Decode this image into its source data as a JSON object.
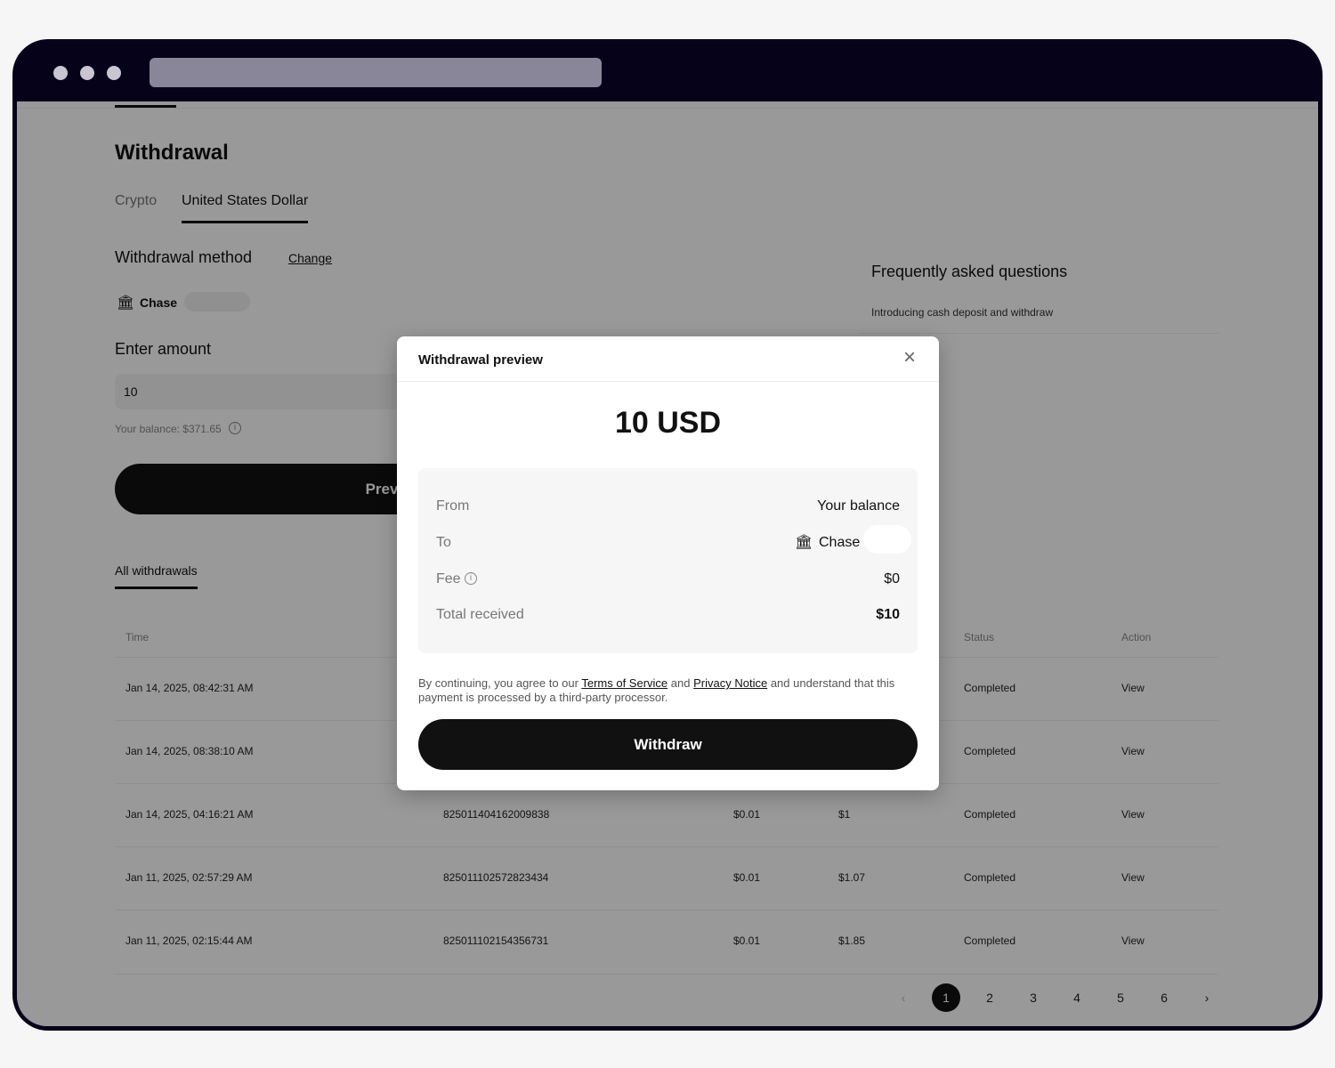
{
  "page": {
    "title": "Withdrawal",
    "tabs": [
      {
        "label": "Crypto",
        "active": false
      },
      {
        "label": "United States Dollar",
        "active": true
      }
    ],
    "method_label": "Withdrawal method",
    "change_label": "Change",
    "bank_name": "Chase",
    "amount_label": "Enter amount",
    "amount_value": "10",
    "balance_text": "Your balance: $371.65",
    "preview_button": "Preview withdrawal",
    "history_tab": "All withdrawals",
    "faq_title": "Frequently asked questions",
    "faq_item": "Introducing cash deposit and withdraw"
  },
  "table": {
    "headers": {
      "time": "Time",
      "status": "Status",
      "action": "Action"
    },
    "rows": [
      {
        "time": "Jan 14, 2025, 08:42:31 AM",
        "id": "",
        "fee": "",
        "amount": "",
        "status": "Completed",
        "action": "View"
      },
      {
        "time": "Jan 14, 2025, 08:38:10 AM",
        "id": "",
        "fee": "",
        "amount": "",
        "status": "Completed",
        "action": "View"
      },
      {
        "time": "Jan 14, 2025, 04:16:21 AM",
        "id": "825011404162009838",
        "fee": "$0.01",
        "amount": "$1",
        "status": "Completed",
        "action": "View"
      },
      {
        "time": "Jan 11, 2025, 02:57:29 AM",
        "id": "825011102572823434",
        "fee": "$0.01",
        "amount": "$1.07",
        "status": "Completed",
        "action": "View"
      },
      {
        "time": "Jan 11, 2025, 02:15:44 AM",
        "id": "825011102154356731",
        "fee": "$0.01",
        "amount": "$1.85",
        "status": "Completed",
        "action": "View"
      }
    ]
  },
  "pagination": {
    "pages": [
      "1",
      "2",
      "3",
      "4",
      "5",
      "6"
    ],
    "current": "1"
  },
  "modal": {
    "title": "Withdrawal preview",
    "amount": "10 USD",
    "from_label": "From",
    "from_value": "Your balance",
    "to_label": "To",
    "to_value": "Chase",
    "fee_label": "Fee",
    "fee_value": "$0",
    "total_label": "Total received",
    "total_value": "$10",
    "disclaimer_1": "By continuing, you agree to our",
    "tos": "Terms of Service",
    "and": "and",
    "privacy": "Privacy Notice",
    "disclaimer_2": "and understand that this payment is processed by a third-party processor.",
    "withdraw_button": "Withdraw"
  }
}
